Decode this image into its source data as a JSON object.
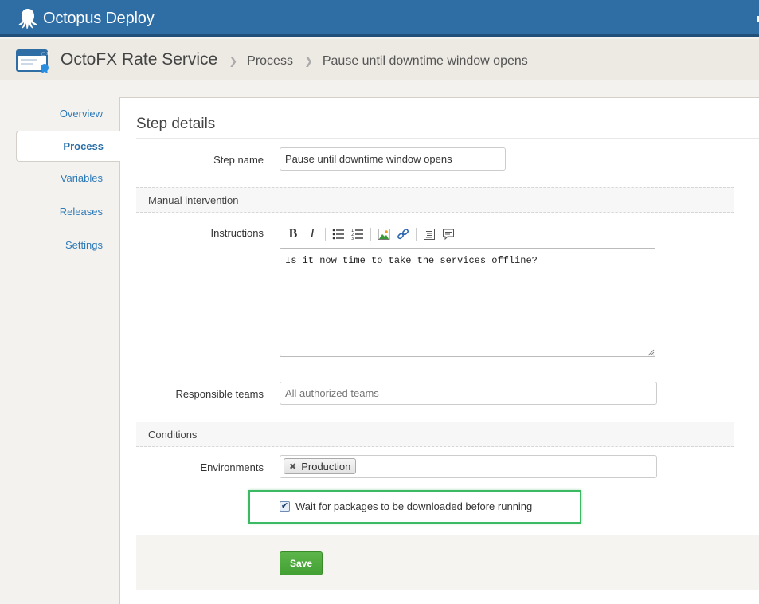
{
  "app": {
    "name": "Octopus Deploy"
  },
  "breadcrumb": {
    "project": "OctoFX Rate Service",
    "items": [
      "Process",
      "Pause until downtime window opens"
    ]
  },
  "sidebar": {
    "items": [
      {
        "label": "Overview"
      },
      {
        "label": "Process"
      },
      {
        "label": "Variables"
      },
      {
        "label": "Releases"
      },
      {
        "label": "Settings"
      }
    ],
    "active": "Process"
  },
  "step": {
    "heading": "Step details",
    "name_label": "Step name",
    "name_value": "Pause until downtime window opens",
    "manual_section": "Manual intervention",
    "instructions_label": "Instructions",
    "instructions_value": "Is it now time to take the services offline?",
    "toolbar_icons": [
      "bold-icon",
      "italic-icon",
      "bullet-list-icon",
      "numbered-list-icon",
      "image-icon",
      "link-icon",
      "code-block-icon",
      "quote-icon"
    ],
    "teams_label": "Responsible teams",
    "teams_placeholder": "All authorized teams",
    "conditions_section": "Conditions",
    "environments_label": "Environments",
    "environment_tags": [
      "Production"
    ],
    "wait_checkbox_label": "Wait for packages to be downloaded before running",
    "wait_checked": true,
    "save_label": "Save"
  },
  "colors": {
    "topbar": "#2f6ea5",
    "link": "#2f7ab8",
    "highlight": "#3cb963",
    "save": "#4aa83a"
  }
}
